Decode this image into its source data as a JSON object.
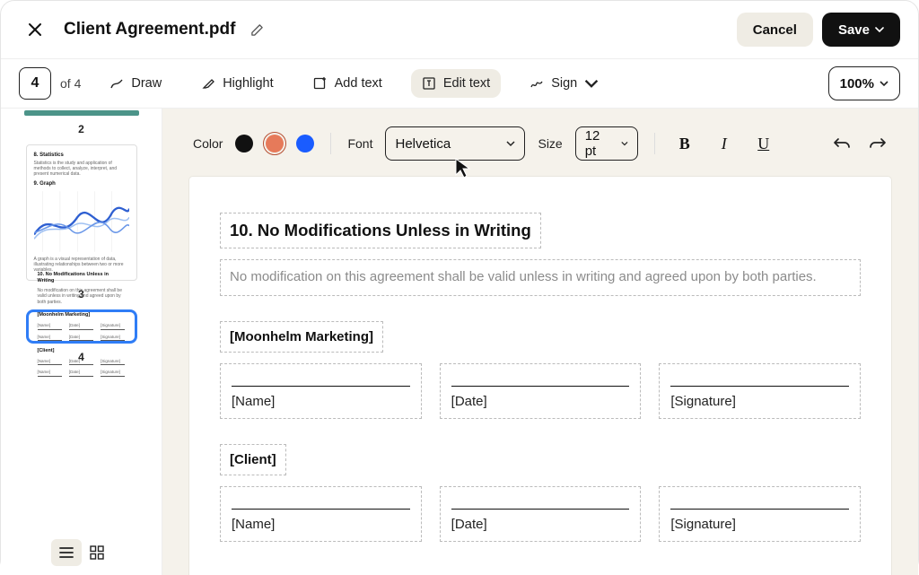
{
  "header": {
    "title": "Client Agreement.pdf",
    "cancel": "Cancel",
    "save": "Save"
  },
  "toolbar": {
    "page_current": "4",
    "page_of": "of 4",
    "draw": "Draw",
    "highlight": "Highlight",
    "add_text": "Add text",
    "edit_text": "Edit text",
    "sign": "Sign",
    "zoom": "100%"
  },
  "fmt": {
    "color_label": "Color",
    "font_label": "Font",
    "font_value": "Helvetica",
    "size_label": "Size",
    "size_value": "12 pt",
    "colors": {
      "black": "#111111",
      "orange": "#e67a5a",
      "blue": "#1a5cff"
    }
  },
  "sidebar": {
    "page2_label": "2",
    "page3_label": "3",
    "page4_label": "4",
    "thumb3": {
      "h1": "8. Statistics",
      "p1": "Statistics is the study and application of methods to collect, analyze, interpret, and present numerical data.",
      "h2": "9. Graph",
      "p2": "A graph is a visual representation of data, illustrating relationships between two or more variables."
    },
    "thumb4": {
      "heading": "10. No Modifications Unless in Writing",
      "para": "No modification on this agreement shall be valid unless in writing and agreed upon by both parties.",
      "party1": "[Moonhelm Marketing]",
      "party2": "[Client]",
      "name": "[Name]",
      "date": "[Date]",
      "sig": "[Signature]"
    }
  },
  "doc": {
    "heading": "10. No Modifications Unless in Writing",
    "para": "No modification on this agreement shall be valid unless in writing and agreed upon by both parties.",
    "party1": "[Moonhelm Marketing]",
    "party2": "[Client]",
    "name": "[Name]",
    "date": "[Date]",
    "sig": "[Signature]"
  }
}
